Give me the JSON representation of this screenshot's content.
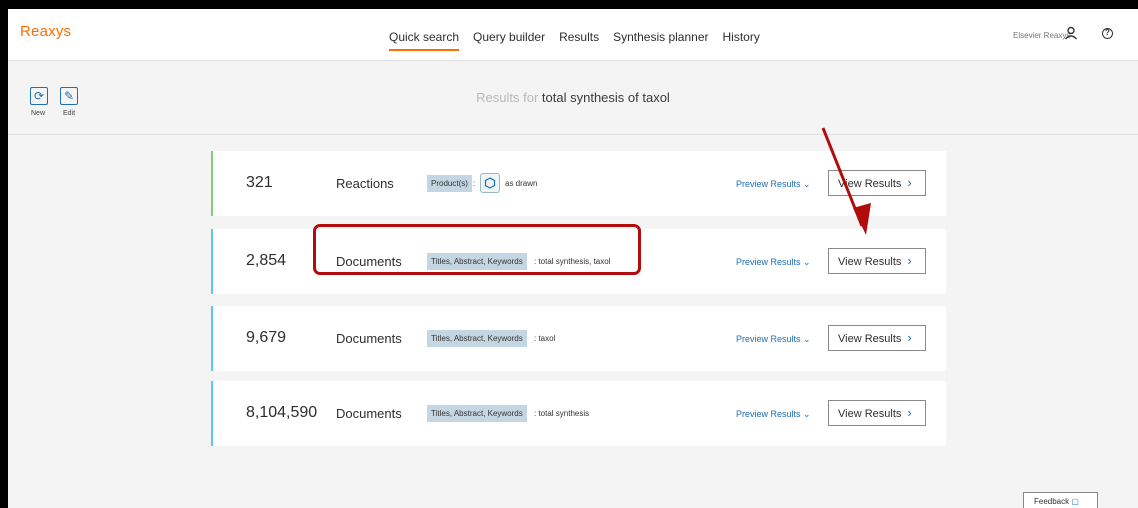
{
  "app": {
    "logo": "Reaxys"
  },
  "nav": [
    "Quick search",
    "Query builder",
    "Results",
    "Synthesis planner",
    "History"
  ],
  "user": {
    "name": "Elsevier Reaxys"
  },
  "toolbar": {
    "new_label": "New",
    "edit_label": "Edit"
  },
  "header": {
    "results_prefix": "Results for",
    "query": "total synthesis of taxol"
  },
  "cards": [
    {
      "count": "321",
      "type": "Reactions",
      "field": "Product(s)",
      "sep": ":",
      "query": "as drawn",
      "preview": "Preview Results",
      "view": "View Results",
      "accent": "#7ed07a"
    },
    {
      "count": "2,854",
      "type": "Documents",
      "field": "Titles, Abstract, Keywords",
      "query": ": total synthesis, taxol",
      "preview": "Preview Results",
      "view": "View Results",
      "accent": "#58c8f0"
    },
    {
      "count": "9,679",
      "type": "Documents",
      "field": "Titles, Abstract, Keywords",
      "query": ": taxol",
      "preview": "Preview Results",
      "view": "View Results",
      "accent": "#58c8f0"
    },
    {
      "count": "8,104,590",
      "type": "Documents",
      "field": "Titles, Abstract, Keywords",
      "query": ": total synthesis",
      "preview": "Preview Results",
      "view": "View Results",
      "accent": "#58c8f0"
    }
  ],
  "feedback": "Feedback",
  "annotation": {
    "arrow_color": "#b20c0c",
    "highlight_color": "#b20c0c"
  }
}
